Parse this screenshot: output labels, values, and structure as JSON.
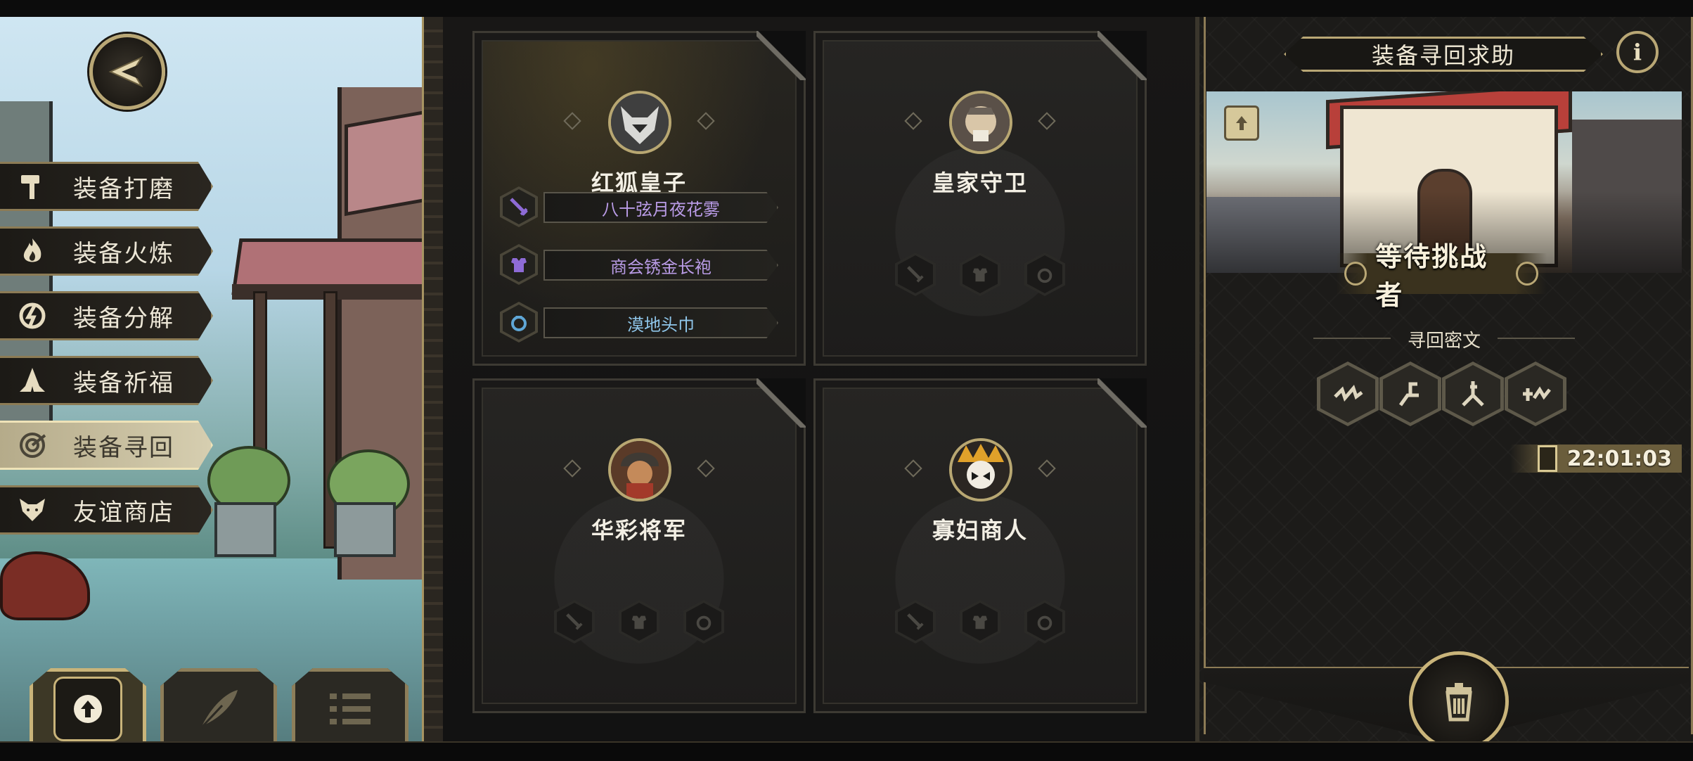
{
  "side_menu": {
    "items": [
      {
        "label": "装备打磨",
        "icon": "hammer-icon"
      },
      {
        "label": "装备火炼",
        "icon": "flame-icon"
      },
      {
        "label": "装备分解",
        "icon": "disassemble-icon"
      },
      {
        "label": "装备祈福",
        "icon": "praying-hands-icon"
      },
      {
        "label": "装备寻回",
        "icon": "target-icon",
        "active": true
      },
      {
        "label": "友谊商店",
        "icon": "fox-head-icon"
      }
    ]
  },
  "bottom_buttons": [
    "upload-file-icon",
    "feather-icon",
    "list-icon"
  ],
  "cards": [
    {
      "name": "红狐皇子",
      "equipment": [
        {
          "name": "八十弦月夜花雾",
          "slot": "weapon",
          "color": "#b99be6"
        },
        {
          "name": "商会锈金长袍",
          "slot": "armor",
          "color": "#b99be6"
        },
        {
          "name": "漠地头巾",
          "slot": "accessory",
          "color": "#8fc6ea"
        }
      ]
    },
    {
      "name": "皇家守卫",
      "equipment": []
    },
    {
      "name": "华彩将军",
      "equipment": []
    },
    {
      "name": "寡妇商人",
      "equipment": []
    }
  ],
  "right_panel": {
    "title": "装备寻回求助",
    "info_label": "i",
    "status": "等待挑战者",
    "cipher_label": "寻回密文",
    "cipher_glyphs": [
      "glyph-1-icon",
      "glyph-2-icon",
      "glyph-3-icon",
      "glyph-4-icon"
    ],
    "timer": "22:01:03"
  },
  "colors": {
    "gold": "#b9a775",
    "purple_item": "#b99be6",
    "blue_item": "#8fc6ea"
  }
}
